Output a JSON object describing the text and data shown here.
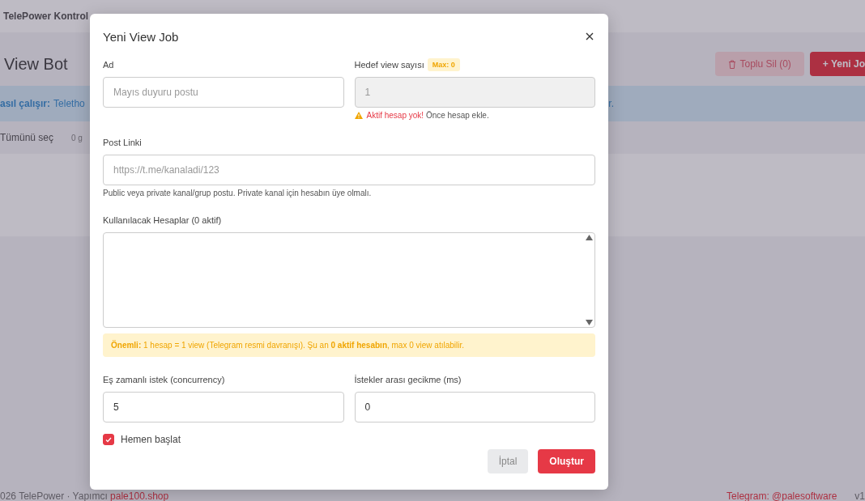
{
  "background": {
    "app_title": "TelePower Kontrol",
    "page_title": "View Bot",
    "bulk_delete": "Toplu Sil (0)",
    "new_job": "+ Yeni Jo",
    "info_label": "asıl çalışır:",
    "info_text": "Teletho",
    "info_end": "r.",
    "select_all": "Tümünü seç",
    "selected_count": "0 g",
    "footer_left": "026 TelePower · Yapımcı",
    "footer_link": "pale100.shop",
    "footer_telegram": "Telegram: @palesoftware",
    "footer_version": "v1"
  },
  "modal": {
    "title": "Yeni View Job",
    "name_field": {
      "label": "Ad",
      "placeholder": "Mayıs duyuru postu"
    },
    "target_field": {
      "label": "Hedef view sayısı",
      "badge": "Max: 0",
      "placeholder": "1",
      "disabled": true,
      "warning_strong": "Aktif hesap yok!",
      "warning_text": "Önce hesap ekle."
    },
    "link_field": {
      "label": "Post Linki",
      "placeholder": "https://t.me/kanaladi/123",
      "help": "Public veya private kanal/grup postu. Private kanal için hesabın üye olmalı."
    },
    "accounts": {
      "label": "Kullanılacak Hesaplar (0 aktif)"
    },
    "notice": "**Önemli:** 1 hesap = 1 view (Telegram resmi davranışı). Şu an **0 aktif hesabın**, max 0 view atılabilir.",
    "concurrency": {
      "label": "Eş zamanlı istek (concurrency)",
      "value": "5"
    },
    "delay": {
      "label": "İstekler arası gecikme (ms)",
      "value": "0"
    },
    "start_now": {
      "label": "Hemen başlat",
      "checked": true
    },
    "buttons": [
      {
        "label": "İptal",
        "kind": "secondary"
      },
      {
        "label": "Oluştur",
        "kind": "primary"
      }
    ]
  }
}
